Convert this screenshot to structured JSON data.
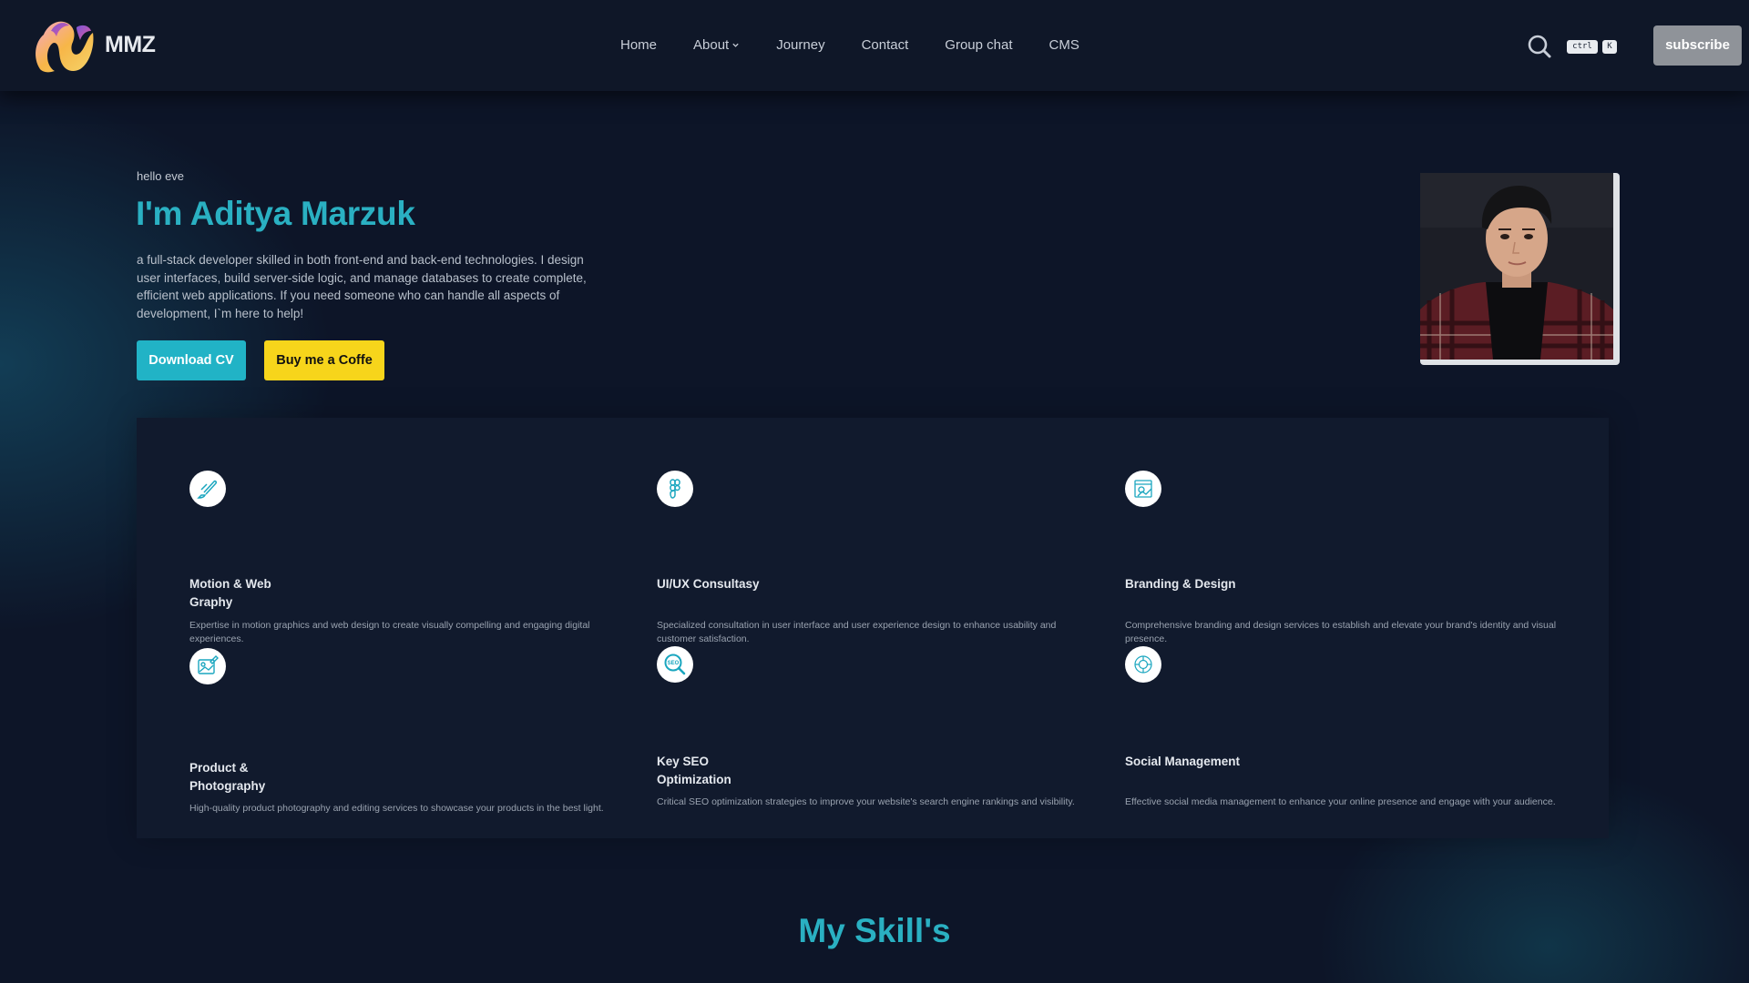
{
  "brand": {
    "name": "MMZ",
    "logo_icon": "mmz-flame-logo"
  },
  "nav": {
    "links": [
      "Home",
      "About",
      "Journey",
      "Contact",
      "Group chat",
      "CMS"
    ],
    "search_icon": "search-icon",
    "shortcut": {
      "key1": "ctrl",
      "key2": "K"
    },
    "subscribe_label": "subscribe"
  },
  "hero": {
    "greeting": "hello eve",
    "title": "I'm Aditya Marzuk",
    "description": "a full-stack developer skilled in both front-end and back-end technologies. I design user interfaces, build server-side logic, and manage databases to create complete, efficient web applications. If you need someone who can handle all aspects of development, I`m here to help!",
    "download_cv": "Download CV",
    "coffee": "Buy me a Coffe"
  },
  "services": [
    {
      "icon": "brush-icon",
      "title": "Motion & Web Graphy",
      "description": "Expertise in motion graphics and web design to create visually compelling and engaging digital experiences."
    },
    {
      "icon": "figma-icon",
      "title": "UI/UX Consultasy",
      "description": "Specialized consultation in user interface and user experience design to enhance usability and customer satisfaction."
    },
    {
      "icon": "branding-icon",
      "title": "Branding & Design",
      "description": "Comprehensive branding and design services to establish and elevate your brand's identity and visual presence."
    },
    {
      "icon": "photo-edit-icon",
      "title": "Product & Photography",
      "description": "High-quality product photography and editing services to showcase your products in the best light."
    },
    {
      "icon": "seo-search-icon",
      "title": "Key SEO Optimization",
      "description": "Critical SEO optimization strategies to improve your website's search engine rankings and visibility."
    },
    {
      "icon": "social-icon",
      "title": "Social Management",
      "description": "Effective social media management to enhance your online presence and engage with your audience."
    }
  ],
  "skills_title": "My Skill's",
  "colors": {
    "accent": "#2ab0c2",
    "coffee": "#f7d51b",
    "background": "#0d1528",
    "navbar": "#0f1728",
    "panel": "#111a2d",
    "subscribe": "#8f9399"
  }
}
